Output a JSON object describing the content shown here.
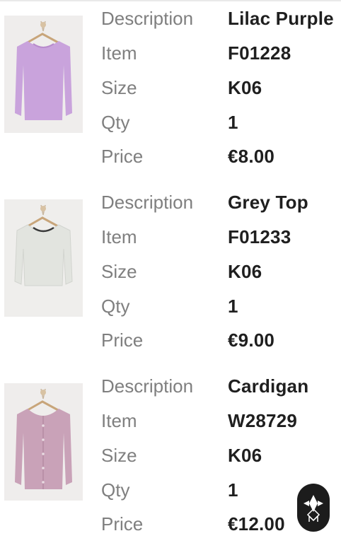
{
  "items": [
    {
      "image_icon": "lilac-top-image",
      "garment_color": "#c9a3dc",
      "fields": [
        {
          "label": "Description",
          "value": "Lilac Purple"
        },
        {
          "label": "Item",
          "value": "F01228"
        },
        {
          "label": "Size",
          "value": "K06"
        },
        {
          "label": "Qty",
          "value": "1"
        },
        {
          "label": "Price",
          "value": "€8.00"
        }
      ]
    },
    {
      "image_icon": "grey-top-image",
      "garment_color": "#e3e5e0",
      "fields": [
        {
          "label": "Description",
          "value": "Grey Top"
        },
        {
          "label": "Item",
          "value": "F01233"
        },
        {
          "label": "Size",
          "value": "K06"
        },
        {
          "label": "Qty",
          "value": "1"
        },
        {
          "label": "Price",
          "value": "€9.00"
        }
      ]
    },
    {
      "image_icon": "cardigan-image",
      "garment_color": "#c9a2b8",
      "fields": [
        {
          "label": "Description",
          "value": "Cardigan"
        },
        {
          "label": "Item",
          "value": "W28729"
        },
        {
          "label": "Size",
          "value": "K06"
        },
        {
          "label": "Qty",
          "value": "1"
        },
        {
          "label": "Price",
          "value": "€12.00"
        }
      ]
    }
  ],
  "floating_button": {
    "icon": "brand-logo-icon"
  },
  "colors": {
    "label": "#7f7f7f",
    "value": "#1f1f1f",
    "fab_background": "#1c1c1c"
  }
}
